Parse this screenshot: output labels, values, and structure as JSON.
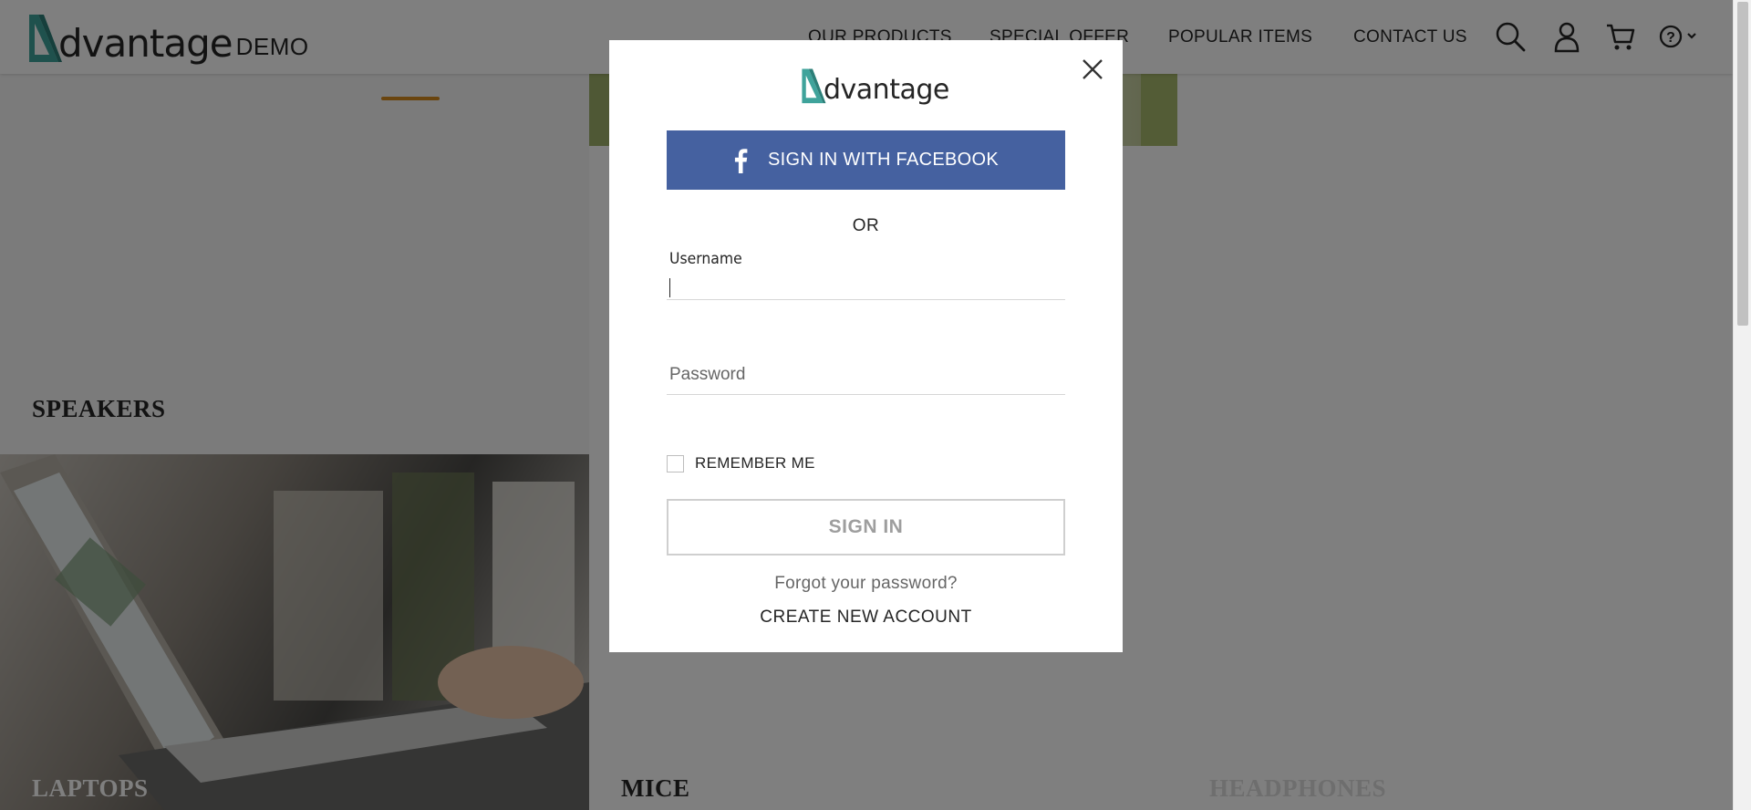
{
  "header": {
    "logo_word": "dvantage",
    "logo_demo": "DEMO",
    "nav": [
      {
        "label": "OUR PRODUCTS"
      },
      {
        "label": "SPECIAL OFFER"
      },
      {
        "label": "POPULAR ITEMS"
      },
      {
        "label": "CONTACT US"
      }
    ],
    "icons": [
      "search-icon",
      "user-icon",
      "cart-icon",
      "help-icon"
    ]
  },
  "categories": {
    "speakers": "SPEAKERS",
    "laptops": "LAPTOPS",
    "mice": "MICE",
    "headphones": "HEADPHONES"
  },
  "modal": {
    "logo_word": "dvantage",
    "facebook_label": "SIGN IN WITH FACEBOOK",
    "or_label": "OR",
    "username_label": "Username",
    "username_value": "",
    "password_placeholder": "Password",
    "remember_label": "REMEMBER ME",
    "remember_checked": false,
    "signin_label": "SIGN IN",
    "forgot_label": "Forgot your password?",
    "create_label": "CREATE NEW ACCOUNT"
  },
  "colors": {
    "brand_teal": "#3fa39b",
    "facebook_blue": "#4561a0",
    "overlay": "rgba(0,0,0,0.5)"
  }
}
